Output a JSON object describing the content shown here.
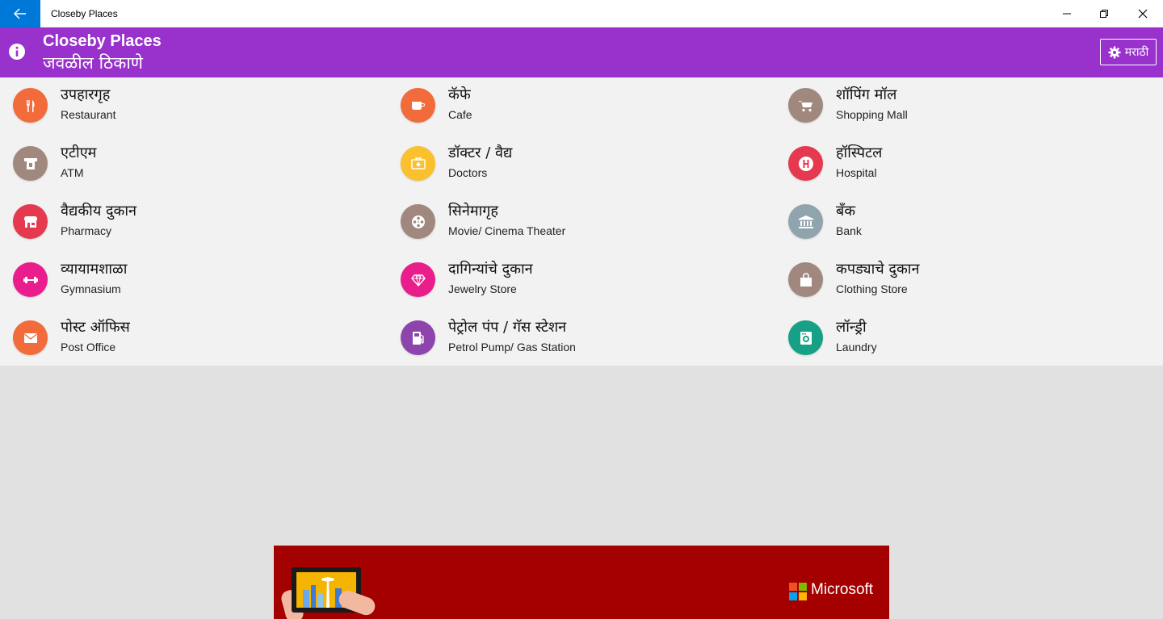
{
  "window": {
    "title": "Closeby Places",
    "back_icon": "arrow-left-icon",
    "controls": [
      "minimize-icon",
      "restore-icon",
      "close-icon"
    ]
  },
  "header": {
    "title": "Closeby Places",
    "subtitle": "जवळील ठिकाणे",
    "language_button": "मराठी",
    "accent_color": "#9932cc"
  },
  "places": [
    {
      "mr": "उपहारगृह",
      "en": "Restaurant",
      "icon": "restaurant-icon",
      "color": "#f26b3a"
    },
    {
      "mr": "कॅफे",
      "en": "Cafe",
      "icon": "cafe-icon",
      "color": "#f26b3a"
    },
    {
      "mr": "शॉपिंग मॉल",
      "en": "Shopping Mall",
      "icon": "shopping-cart-icon",
      "color": "#a1887f"
    },
    {
      "mr": "एटीएम",
      "en": "ATM",
      "icon": "atm-icon",
      "color": "#a1887f"
    },
    {
      "mr": "डॉक्टर / वैद्य",
      "en": "Doctors",
      "icon": "doctor-bag-icon",
      "color": "#fbc02d"
    },
    {
      "mr": "हॉस्पिटल",
      "en": "Hospital",
      "icon": "hospital-icon",
      "color": "#e53950"
    },
    {
      "mr": "वैद्यकीय दुकान",
      "en": "Pharmacy",
      "icon": "pharmacy-store-icon",
      "color": "#e53950"
    },
    {
      "mr": "सिनेमागृह",
      "en": "Movie/ Cinema Theater",
      "icon": "film-reel-icon",
      "color": "#a1887f"
    },
    {
      "mr": "बँक",
      "en": "Bank",
      "icon": "bank-icon",
      "color": "#90a4ae"
    },
    {
      "mr": "व्यायामशाळा",
      "en": "Gymnasium",
      "icon": "dumbbell-icon",
      "color": "#e91e8c"
    },
    {
      "mr": "दागिन्यांचे दुकान",
      "en": "Jewelry Store",
      "icon": "diamond-icon",
      "color": "#e91e8c"
    },
    {
      "mr": "कपड्याचे दुकान",
      "en": "Clothing Store",
      "icon": "shopping-bag-icon",
      "color": "#a1887f"
    },
    {
      "mr": "पोस्ट ऑफिस",
      "en": "Post Office",
      "icon": "envelope-icon",
      "color": "#f26b3a"
    },
    {
      "mr": "पेट्रोल पंप / गॅस स्टेशन",
      "en": "Petrol Pump/ Gas Station",
      "icon": "fuel-pump-icon",
      "color": "#8e44ad"
    },
    {
      "mr": "लॉन्ड्री",
      "en": "Laundry",
      "icon": "washing-machine-icon",
      "color": "#16a085"
    }
  ],
  "ad": {
    "brand": "Microsoft",
    "background": "#a50000"
  }
}
